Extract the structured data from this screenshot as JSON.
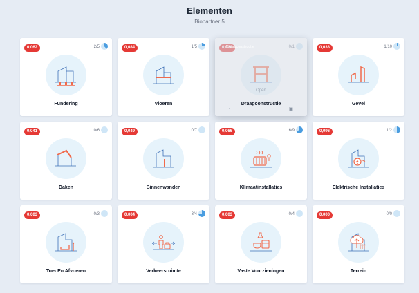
{
  "header": {
    "title": "Elementen",
    "subtitle": "Biopartner 5"
  },
  "colors": {
    "badge": "#e53935",
    "accent_red": "#f16a4b",
    "line_blue": "#3d6fb6",
    "icon_bg": "#e6f3fb",
    "pie_fill": "#4a9de0",
    "pie_bg": "#cfe6f7"
  },
  "hover_card": {
    "hint": "Draagconstructie",
    "open_label": "Open"
  },
  "cards": [
    {
      "name": "Fundering",
      "price": "0,062",
      "progress": "2/5",
      "fraction": 0.4,
      "icon": "foundation-icon"
    },
    {
      "name": "Vloeren",
      "price": "0,084",
      "progress": "1/5",
      "fraction": 0.2,
      "icon": "floor-icon"
    },
    {
      "name": "Draagconstructie",
      "price": "0,020",
      "progress": "0/1",
      "fraction": 0.0,
      "icon": "structure-icon"
    },
    {
      "name": "Gevel",
      "price": "0,033",
      "progress": "1/10",
      "fraction": 0.1,
      "icon": "facade-icon"
    },
    {
      "name": "Daken",
      "price": "0,041",
      "progress": "0/6",
      "fraction": 0.0,
      "icon": "roof-icon"
    },
    {
      "name": "Binnenwanden",
      "price": "0,049",
      "progress": "0/7",
      "fraction": 0.0,
      "icon": "inner-wall-icon"
    },
    {
      "name": "Klimaatinstallaties",
      "price": "0,066",
      "progress": "6/9",
      "fraction": 0.667,
      "icon": "radiator-icon"
    },
    {
      "name": "Elektrische Installaties",
      "price": "0,096",
      "progress": "1/2",
      "fraction": 0.5,
      "icon": "electric-icon"
    },
    {
      "name": "Toe- En Afvoeren",
      "price": "0,003",
      "progress": "0/3",
      "fraction": 0.0,
      "icon": "pipes-icon"
    },
    {
      "name": "Verkeersruimte",
      "price": "0,004",
      "progress": "3/4",
      "fraction": 0.75,
      "icon": "circulation-icon"
    },
    {
      "name": "Vaste Voorzieningen",
      "price": "0,003",
      "progress": "0/4",
      "fraction": 0.0,
      "icon": "fixtures-icon"
    },
    {
      "name": "Terrein",
      "price": "0,000",
      "progress": "0/0",
      "fraction": 0.0,
      "icon": "terrain-icon"
    }
  ]
}
